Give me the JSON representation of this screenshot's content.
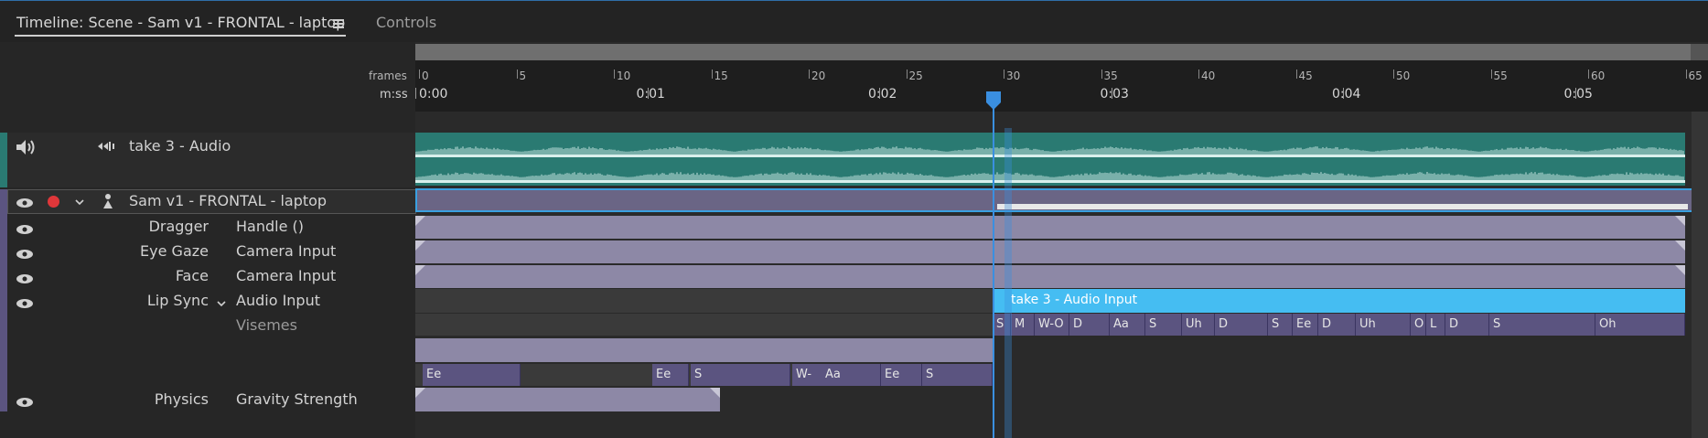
{
  "tabs": [
    {
      "label": "Timeline: Scene - Sam v1 - FRONTAL - laptop",
      "active": true
    },
    {
      "label": "Controls",
      "active": false
    }
  ],
  "ruler": {
    "frames_label": "frames",
    "mss_label": "m:ss",
    "frames": [
      "0",
      "5",
      "10",
      "15",
      "20",
      "25",
      "30",
      "35",
      "40",
      "45",
      "50",
      "55",
      "60",
      "65"
    ],
    "times": [
      "0:00",
      "0:01",
      "0:02",
      "0:03",
      "0:04",
      "0:05"
    ],
    "playhead_frame": 30
  },
  "tracks": {
    "audio": {
      "name": "take 3 - Audio"
    },
    "puppet": {
      "name": "Sam v1 - FRONTAL - laptop"
    },
    "rows": [
      {
        "behavior": "Dragger",
        "input": "Handle ()"
      },
      {
        "behavior": "Eye Gaze",
        "input": "Camera Input"
      },
      {
        "behavior": "Face",
        "input": "Camera Input"
      },
      {
        "behavior": "Lip Sync",
        "input": "Audio Input"
      },
      {
        "behavior": "",
        "input": "Visemes"
      },
      {
        "behavior": "Physics",
        "input": "Gravity Strength"
      }
    ]
  },
  "lipsync_take": "take 3 - Audio Input",
  "visemes_top": [
    "S",
    "M",
    "W-O",
    "D",
    "Aa",
    "S",
    "Uh",
    "D",
    "S",
    "Ee",
    "D",
    "Uh",
    "O",
    "L",
    "D",
    "S",
    "Oh"
  ],
  "visemes_bottom": [
    "Ee",
    "Ee",
    "S",
    "W-",
    "Aa",
    "Ee",
    "S"
  ],
  "colors": {
    "audio_clip": "#2a7a72",
    "lipsync_clip": "#45bdf2",
    "viseme": "#5b5480",
    "param_bar": "#8d88a6",
    "playhead": "#3a8fe0",
    "record_dot": "#e0373a"
  }
}
